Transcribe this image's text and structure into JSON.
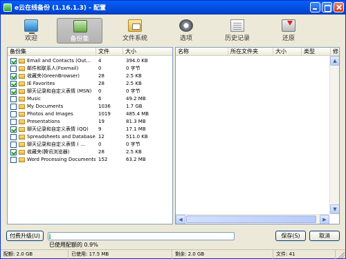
{
  "window": {
    "title": "e云在线备份 (1.16.1.3) - 配置"
  },
  "toolbar": {
    "tabs": [
      {
        "label": "欢迎",
        "icon": "monitor-icon",
        "selected": false
      },
      {
        "label": "备份集",
        "icon": "backup-set-icon",
        "selected": true
      },
      {
        "label": "文件系统",
        "icon": "file-system-icon",
        "selected": false
      },
      {
        "label": "选项",
        "icon": "gear-icon",
        "selected": false
      },
      {
        "label": "历史记录",
        "icon": "history-icon",
        "selected": false
      },
      {
        "label": "还原",
        "icon": "restore-icon",
        "selected": false
      }
    ]
  },
  "backup_list": {
    "headers": {
      "name": "备份集",
      "files": "文件",
      "size": "大小"
    },
    "rows": [
      {
        "checked": true,
        "name": "Email and Contacts (Out...",
        "files": "4",
        "size": "394.0 KB"
      },
      {
        "checked": false,
        "name": "邮件和联系人(Foxmail)",
        "files": "0",
        "size": "0 字节"
      },
      {
        "checked": true,
        "name": "收藏夹(GreenBrowser)",
        "files": "28",
        "size": "2.5 KB"
      },
      {
        "checked": true,
        "name": "IE Favorites",
        "files": "28",
        "size": "2.5 KB"
      },
      {
        "checked": true,
        "name": "聊天记录和自定义表情 (MSN)",
        "files": "0",
        "size": "0 字节"
      },
      {
        "checked": false,
        "name": "Music",
        "files": "6",
        "size": "49.2 MB"
      },
      {
        "checked": false,
        "name": "My Documents",
        "files": "1036",
        "size": "1.7 GB"
      },
      {
        "checked": false,
        "name": "Photos and Images",
        "files": "1019",
        "size": "485.4 MB"
      },
      {
        "checked": false,
        "name": "Presentations",
        "files": "19",
        "size": "81.3 MB"
      },
      {
        "checked": true,
        "name": "聊天记录和自定义表情 (QQ)",
        "files": "9",
        "size": "17.1 MB"
      },
      {
        "checked": false,
        "name": "Spreadsheets and Databases",
        "files": "12",
        "size": "511.0 KB"
      },
      {
        "checked": false,
        "name": "聊天记录和自定义表情 ( ...",
        "files": "0",
        "size": "0 字节"
      },
      {
        "checked": true,
        "name": "收藏夹(腾讯浏览器)",
        "files": "28",
        "size": "2.5 KB"
      },
      {
        "checked": false,
        "name": "Word Processing Documents",
        "files": "152",
        "size": "63.2 MB"
      }
    ]
  },
  "file_list": {
    "headers": {
      "name": "名称",
      "folder": "所在文件夹",
      "size": "大小",
      "type": "类型",
      "more": "修"
    }
  },
  "buttons": {
    "upgrade": "付费升级(U)",
    "save": "保存(S)",
    "cancel": "取消"
  },
  "quota": {
    "used_fraction": 0.009,
    "text": "已使用配额的 0.9%"
  },
  "statusbar": {
    "quota": "配额: 2.0 GB",
    "used": "已使用: 17.5 MB",
    "remaining": "剩余: 2.0 GB",
    "files": "文件: 41"
  },
  "colors": {
    "titlebar": "#0054e3",
    "progress": "#33b533",
    "selected_tab": "#b3b3b3"
  }
}
